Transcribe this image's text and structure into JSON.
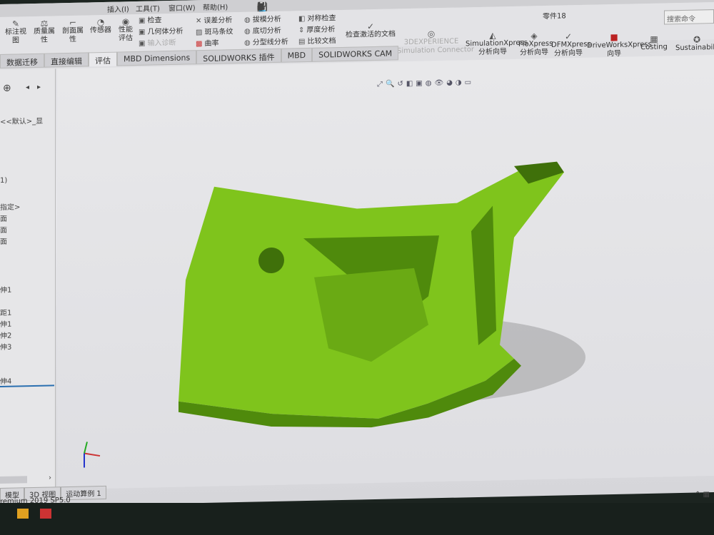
{
  "menu": [
    "插入(I)",
    "工具(T)",
    "窗口(W)",
    "帮助(H)"
  ],
  "window_title": "零件18",
  "search_placeholder": "搜索命令",
  "ribbon": {
    "large": [
      {
        "label": "标注视\n图",
        "icon": "annotation-view-icon"
      },
      {
        "label": "质量属\n性",
        "icon": "scale-icon"
      },
      {
        "label": "剖面属\n性",
        "icon": "section-icon"
      },
      {
        "label": "传感器",
        "icon": "gauge-icon"
      },
      {
        "label": "性能\n评估",
        "icon": "performance-icon"
      }
    ],
    "small": [
      {
        "label": "检查",
        "icon": "check-icon"
      },
      {
        "label": "几何体分析",
        "icon": "geometry-analysis-icon"
      },
      {
        "label": "输入诊断",
        "icon": "import-diagnostics-icon",
        "disabled": true
      },
      {
        "label": "误差分析",
        "icon": "deviation-icon"
      },
      {
        "label": "斑马条纹",
        "icon": "zebra-icon"
      },
      {
        "label": "曲率",
        "icon": "curvature-icon"
      },
      {
        "label": "拔模分析",
        "icon": "draft-icon"
      },
      {
        "label": "底切分析",
        "icon": "undercut-icon"
      },
      {
        "label": "分型线分析",
        "icon": "parting-line-icon"
      },
      {
        "label": "对称检查",
        "icon": "symmetry-icon"
      },
      {
        "label": "厚度分析",
        "icon": "thickness-icon"
      },
      {
        "label": "比较文档",
        "icon": "compare-icon"
      }
    ],
    "check_active": "检查激活的文档",
    "addins": [
      {
        "label": "3DEXPERIENCE\nSimulation Connector",
        "disabled": true
      },
      {
        "label": "SimulationXpress\n分析向导"
      },
      {
        "label": "FloXpress\n分析向导"
      },
      {
        "label": "DFMXpress\n分析向导"
      },
      {
        "label": "DriveWorksXpress\n向导"
      },
      {
        "label": "Costing"
      },
      {
        "label": "Sustainability"
      }
    ]
  },
  "tabs": [
    "数据迁移",
    "直接编辑",
    "评估",
    "MBD Dimensions",
    "SOLIDWORKS 插件",
    "MBD",
    "SOLIDWORKS CAM"
  ],
  "active_tab": "评估",
  "tree": [
    "<<默认>_显",
    "1)",
    "指定>",
    "面",
    "面",
    "面",
    "伸1",
    "距1",
    "伸1",
    "伸2",
    "伸3",
    "伸4"
  ],
  "bottom_tabs": [
    "模型",
    "3D 视图",
    "运动算例 1"
  ],
  "status": "remium 2019 SP5.0",
  "colors": {
    "model": "#7fc41c",
    "model_dark": "#4f8a0c",
    "accent": "#2a6fb0"
  }
}
